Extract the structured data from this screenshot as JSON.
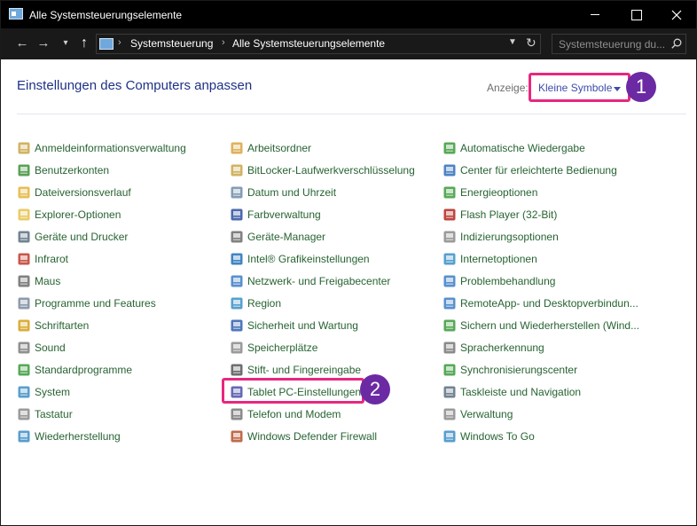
{
  "window": {
    "title": "Alle Systemsteuerungselemente"
  },
  "address": {
    "crumbs": [
      "Systemsteuerung",
      "Alle Systemsteuerungselemente"
    ]
  },
  "search": {
    "placeholder": "Systemsteuerung du..."
  },
  "header": {
    "title": "Einstellungen des Computers anpassen",
    "view_label": "Anzeige:",
    "view_value": "Kleine Symbole"
  },
  "annotations": {
    "badge_1": "1",
    "badge_2": "2"
  },
  "columns": [
    [
      {
        "label": "Anmeldeinformationsverwaltung",
        "icon": "credential-manager-icon",
        "color": "#c9a646"
      },
      {
        "label": "Benutzerkonten",
        "icon": "user-accounts-icon",
        "color": "#3f8f3b"
      },
      {
        "label": "Dateiversionsverlauf",
        "icon": "file-history-icon",
        "color": "#e2b43a"
      },
      {
        "label": "Explorer-Optionen",
        "icon": "explorer-options-icon",
        "color": "#e6c24d"
      },
      {
        "label": "Geräte und Drucker",
        "icon": "devices-printers-icon",
        "color": "#5b6f80"
      },
      {
        "label": "Infrarot",
        "icon": "infrared-icon",
        "color": "#c0392b"
      },
      {
        "label": "Maus",
        "icon": "mouse-icon",
        "color": "#6b6b6b"
      },
      {
        "label": "Programme und Features",
        "icon": "programs-features-icon",
        "color": "#7a8aa0"
      },
      {
        "label": "Schriftarten",
        "icon": "fonts-icon",
        "color": "#d4a017"
      },
      {
        "label": "Sound",
        "icon": "sound-icon",
        "color": "#7d7d7d"
      },
      {
        "label": "Standardprogramme",
        "icon": "default-programs-icon",
        "color": "#3a9a3a"
      },
      {
        "label": "System",
        "icon": "system-icon",
        "color": "#3c8dc5"
      },
      {
        "label": "Tastatur",
        "icon": "keyboard-icon",
        "color": "#8a8a8a"
      },
      {
        "label": "Wiederherstellung",
        "icon": "recovery-icon",
        "color": "#3c8dc5"
      }
    ],
    [
      {
        "label": "Arbeitsordner",
        "icon": "work-folders-icon",
        "color": "#d9a441"
      },
      {
        "label": "BitLocker-Laufwerkverschlüsselung",
        "icon": "bitlocker-icon",
        "color": "#c9a646"
      },
      {
        "label": "Datum und Uhrzeit",
        "icon": "date-time-icon",
        "color": "#6e8ca8"
      },
      {
        "label": "Farbverwaltung",
        "icon": "color-management-icon",
        "color": "#2b4f9e"
      },
      {
        "label": "Geräte-Manager",
        "icon": "device-manager-icon",
        "color": "#6b6b6b"
      },
      {
        "label": "Intel® Grafikeinstellungen",
        "icon": "intel-graphics-icon",
        "color": "#1f70b8"
      },
      {
        "label": "Netzwerk- und Freigabecenter",
        "icon": "network-sharing-icon",
        "color": "#3c7dc5"
      },
      {
        "label": "Region",
        "icon": "region-icon",
        "color": "#3a8fc7"
      },
      {
        "label": "Sicherheit und Wartung",
        "icon": "security-maintenance-icon",
        "color": "#2f5fb0"
      },
      {
        "label": "Speicherplätze",
        "icon": "storage-spaces-icon",
        "color": "#8a8a8a"
      },
      {
        "label": "Stift- und Fingereingabe",
        "icon": "pen-touch-icon",
        "color": "#555555"
      },
      {
        "label": "Tablet PC-Einstellungen",
        "icon": "tablet-pc-icon",
        "color": "#4b4fa8"
      },
      {
        "label": "Telefon und Modem",
        "icon": "phone-modem-icon",
        "color": "#777777"
      },
      {
        "label": "Windows Defender Firewall",
        "icon": "firewall-icon",
        "color": "#b5512b"
      }
    ],
    [
      {
        "label": "Automatische Wiedergabe",
        "icon": "autoplay-icon",
        "color": "#3a9a3a"
      },
      {
        "label": "Center für erleichterte Bedienung",
        "icon": "ease-of-access-icon",
        "color": "#2e6fb8"
      },
      {
        "label": "Energieoptionen",
        "icon": "power-options-icon",
        "color": "#3a9a3a"
      },
      {
        "label": "Flash Player (32-Bit)",
        "icon": "flash-player-icon",
        "color": "#b3261e"
      },
      {
        "label": "Indizierungsoptionen",
        "icon": "indexing-options-icon",
        "color": "#8a8a8a"
      },
      {
        "label": "Internetoptionen",
        "icon": "internet-options-icon",
        "color": "#3a8fc7"
      },
      {
        "label": "Problembehandlung",
        "icon": "troubleshooting-icon",
        "color": "#3c7dc5"
      },
      {
        "label": "RemoteApp- und Desktopverbindun...",
        "icon": "remoteapp-icon",
        "color": "#3c7dc5"
      },
      {
        "label": "Sichern und Wiederherstellen (Wind...",
        "icon": "backup-restore-icon",
        "color": "#3a9a3a"
      },
      {
        "label": "Spracherkennung",
        "icon": "speech-recognition-icon",
        "color": "#777777"
      },
      {
        "label": "Synchronisierungscenter",
        "icon": "sync-center-icon",
        "color": "#3a9a3a"
      },
      {
        "label": "Taskleiste und Navigation",
        "icon": "taskbar-navigation-icon",
        "color": "#5b6f80"
      },
      {
        "label": "Verwaltung",
        "icon": "administrative-tools-icon",
        "color": "#8a8a8a"
      },
      {
        "label": "Windows To Go",
        "icon": "windows-to-go-icon",
        "color": "#3c8dc5"
      }
    ]
  ],
  "colors": {
    "heading": "#1e3287",
    "link": "#276332",
    "annotation_border": "#e8277f",
    "annotation_badge": "#6b2aa3"
  }
}
